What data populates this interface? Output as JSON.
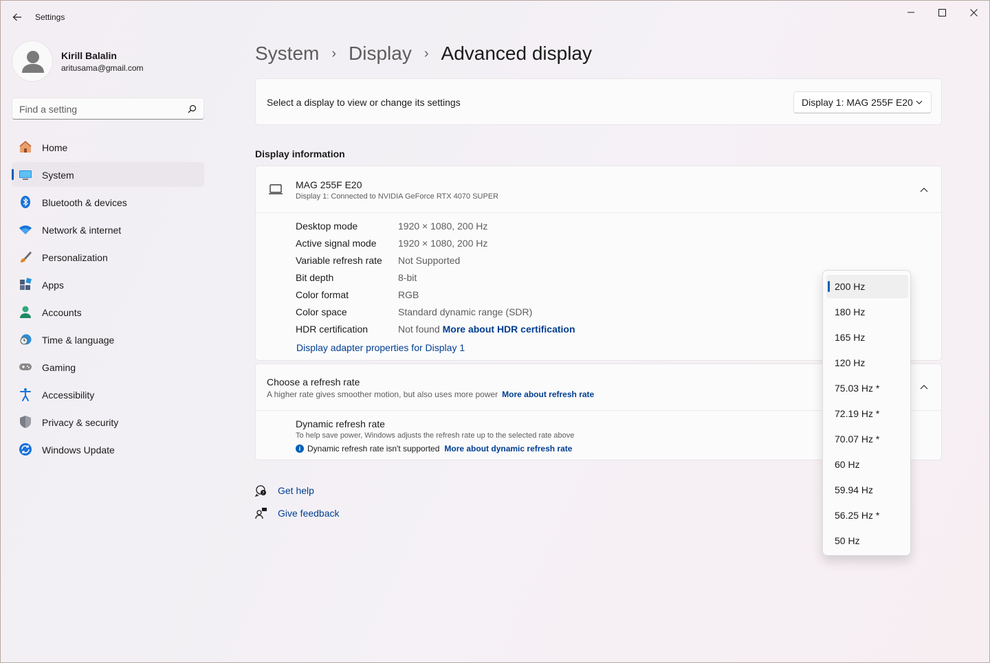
{
  "app": {
    "title": "Settings"
  },
  "profile": {
    "name": "Kirill Balalin",
    "email": "aritusama@gmail.com"
  },
  "search": {
    "placeholder": "Find a setting"
  },
  "nav": {
    "items": [
      {
        "label": "Home",
        "icon": "home-icon"
      },
      {
        "label": "System",
        "icon": "system-icon",
        "active": true
      },
      {
        "label": "Bluetooth & devices",
        "icon": "bluetooth-icon"
      },
      {
        "label": "Network & internet",
        "icon": "wifi-icon"
      },
      {
        "label": "Personalization",
        "icon": "brush-icon"
      },
      {
        "label": "Apps",
        "icon": "apps-icon"
      },
      {
        "label": "Accounts",
        "icon": "accounts-icon"
      },
      {
        "label": "Time & language",
        "icon": "clock-globe-icon"
      },
      {
        "label": "Gaming",
        "icon": "gamepad-icon"
      },
      {
        "label": "Accessibility",
        "icon": "accessibility-icon"
      },
      {
        "label": "Privacy & security",
        "icon": "shield-icon"
      },
      {
        "label": "Windows Update",
        "icon": "update-icon"
      }
    ]
  },
  "breadcrumb": {
    "items": [
      "System",
      "Display"
    ],
    "current": "Advanced display",
    "separator": "›"
  },
  "display_select": {
    "label": "Select a display to view or change its settings",
    "value": "Display 1: MAG 255F E20"
  },
  "display_info": {
    "section_title": "Display information",
    "monitor_name": "MAG 255F E20",
    "monitor_sub": "Display 1: Connected to NVIDIA GeForce RTX 4070 SUPER",
    "rows": [
      {
        "key": "Desktop mode",
        "value": "1920 × 1080, 200 Hz"
      },
      {
        "key": "Active signal mode",
        "value": "1920 × 1080, 200 Hz"
      },
      {
        "key": "Variable refresh rate",
        "value": "Not Supported"
      },
      {
        "key": "Bit depth",
        "value": "8-bit"
      },
      {
        "key": "Color format",
        "value": "RGB"
      },
      {
        "key": "Color space",
        "value": "Standard dynamic range (SDR)"
      },
      {
        "key": "HDR certification",
        "value": "Not found",
        "link": "More about HDR certification"
      }
    ],
    "adapter_link": "Display adapter properties for Display 1"
  },
  "refresh": {
    "title": "Choose a refresh rate",
    "subtitle": "A higher rate gives smoother motion, but also uses more power",
    "subtitle_link": "More about refresh rate",
    "dynamic_title": "Dynamic refresh rate",
    "dynamic_sub": "To help save power, Windows adjusts the refresh rate up to the selected rate above",
    "dynamic_warning": "Dynamic refresh rate isn't supported",
    "dynamic_link": "More about dynamic refresh rate"
  },
  "help": {
    "get_help": "Get help",
    "give_feedback": "Give feedback"
  },
  "dropdown": {
    "options": [
      "200 Hz",
      "180 Hz",
      "165 Hz",
      "120 Hz",
      "75.03 Hz *",
      "72.19 Hz *",
      "70.07 Hz *",
      "60 Hz",
      "59.94 Hz",
      "56.25 Hz *",
      "50 Hz"
    ],
    "selected": "200 Hz"
  },
  "colors": {
    "accent": "#005fb8",
    "link": "#003e92"
  }
}
